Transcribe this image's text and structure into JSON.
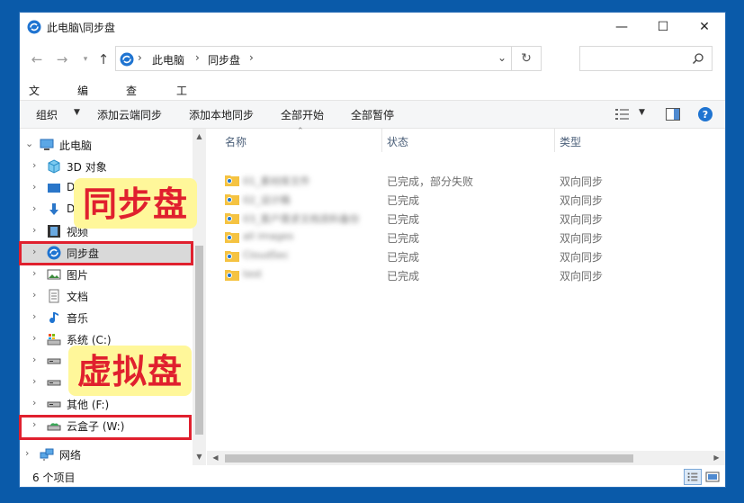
{
  "window": {
    "title": "此电脑\\同步盘",
    "minimize_glyph": "—",
    "maximize_glyph": "☐",
    "close_glyph": "✕"
  },
  "address": {
    "segments": [
      "此电脑",
      "同步盘"
    ],
    "sep": "›",
    "search_placeholder": ""
  },
  "menu": [
    "文件(F)",
    "编辑(E)",
    "查看(V)",
    "工具(T)"
  ],
  "commands": [
    "组织",
    "添加云端同步",
    "添加本地同步",
    "全部开始",
    "全部暂停"
  ],
  "nav": {
    "items": [
      {
        "label": "此电脑",
        "icon": "computer-icon"
      },
      {
        "label": "3D 对象",
        "icon": "cube-icon"
      },
      {
        "label": "D",
        "icon": "desktop-icon"
      },
      {
        "label": "D",
        "icon": "download-icon"
      },
      {
        "label": "视频",
        "icon": "video-icon"
      },
      {
        "label": "同步盘",
        "icon": "sync-drive-icon"
      },
      {
        "label": "图片",
        "icon": "pictures-icon"
      },
      {
        "label": "文档",
        "icon": "documents-icon"
      },
      {
        "label": "音乐",
        "icon": "music-icon"
      },
      {
        "label": "系统 (C:)",
        "icon": "system-drive-icon"
      },
      {
        "label": "",
        "icon": "drive-icon"
      },
      {
        "label": "",
        "icon": "drive-icon"
      },
      {
        "label": "其他 (F:)",
        "icon": "drive-icon"
      },
      {
        "label": "云盒子 (W:)",
        "icon": "cloud-drive-icon"
      },
      {
        "label": "网络",
        "icon": "network-icon"
      }
    ]
  },
  "list": {
    "columns": [
      "名称",
      "状态",
      "类型"
    ],
    "rows": [
      {
        "name": "01_素材库文件",
        "status": "已完成，部分失败",
        "type": "双向同步"
      },
      {
        "name": "02_设计稿",
        "status": "已完成",
        "type": "双向同步"
      },
      {
        "name": "03_客户需求文档资料备份",
        "status": "已完成",
        "type": "双向同步"
      },
      {
        "name": "all images",
        "status": "已完成",
        "type": "双向同步"
      },
      {
        "name": "CloudSec",
        "status": "已完成",
        "type": "双向同步"
      },
      {
        "name": "test",
        "status": "已完成",
        "type": "双向同步"
      }
    ]
  },
  "status": {
    "item_count": "6 个项目"
  },
  "annotations": {
    "sync_label": "同步盘",
    "virtual_label": "虚拟盘"
  },
  "colors": {
    "accent": "#0a5aa9",
    "highlight_red": "#e0202e",
    "callout_yellow": "#fff79a"
  }
}
